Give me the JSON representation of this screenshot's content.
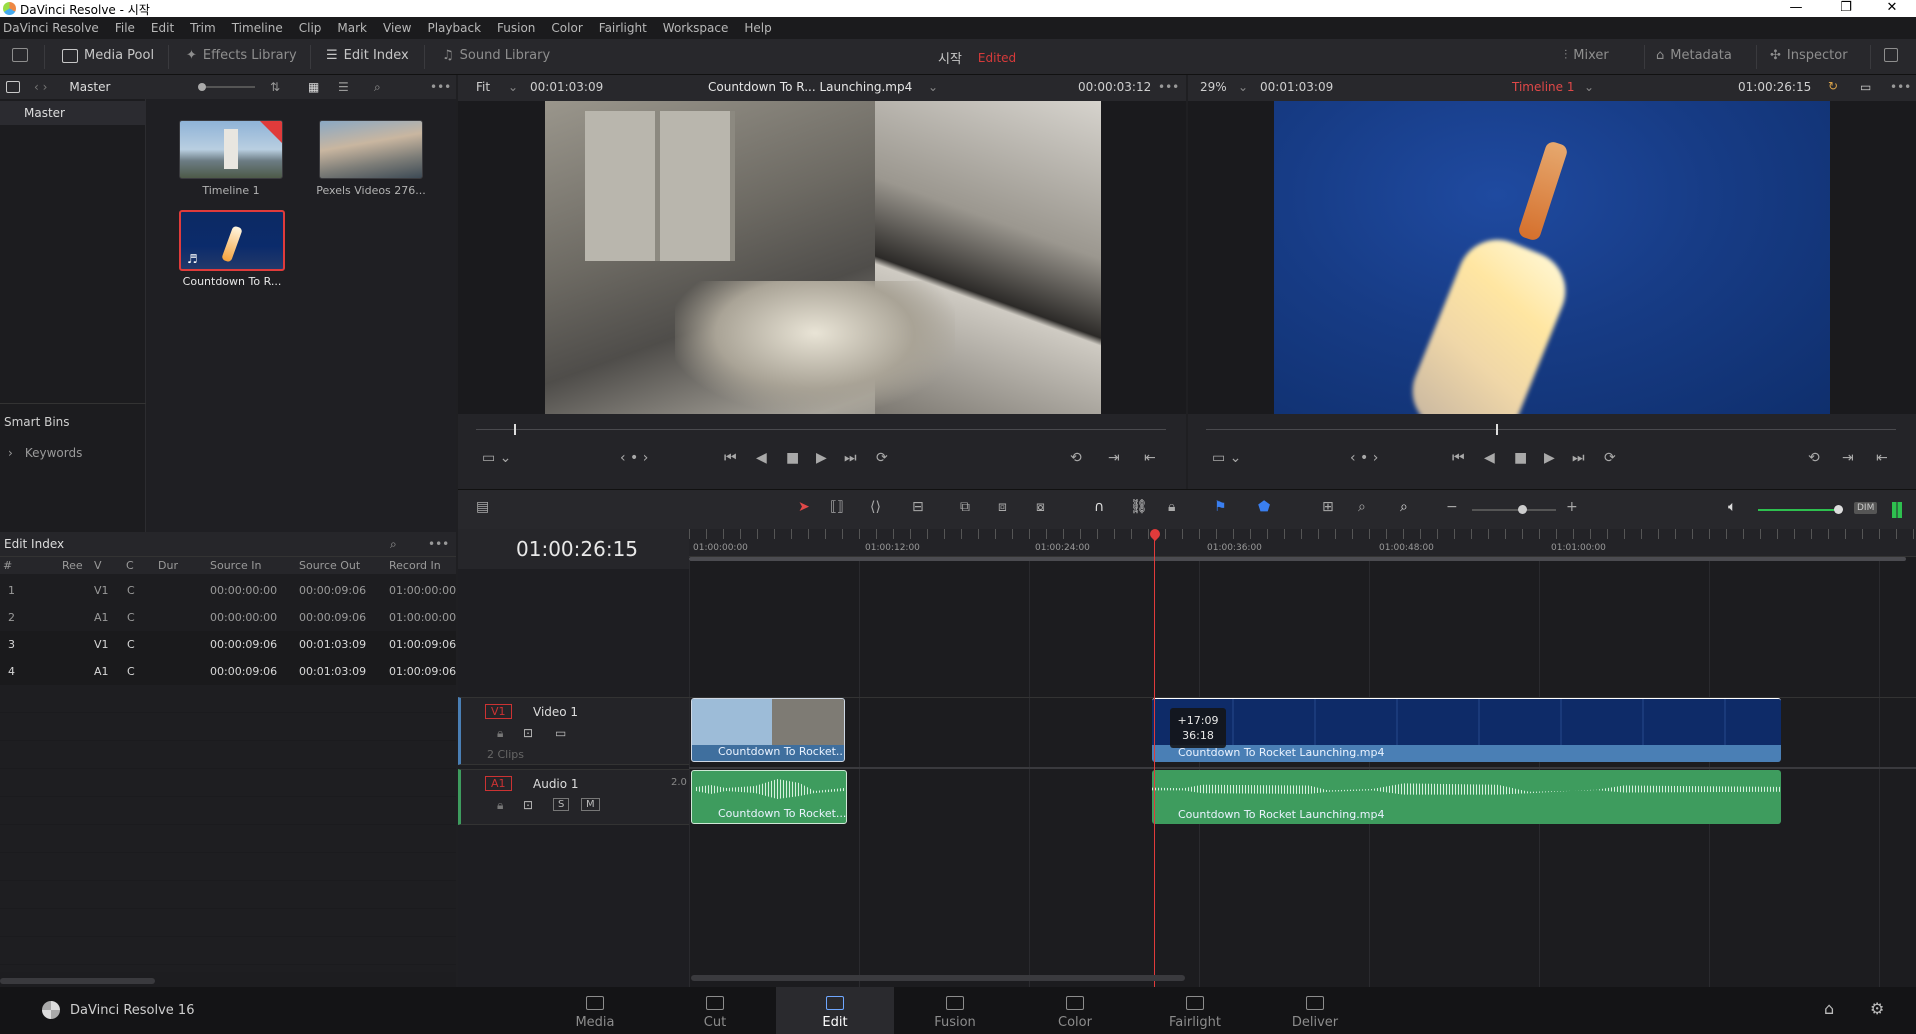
{
  "window": {
    "title": "DaVinci Resolve - 시작"
  },
  "menu": [
    "DaVinci Resolve",
    "File",
    "Edit",
    "Trim",
    "Timeline",
    "Clip",
    "Mark",
    "View",
    "Playback",
    "Fusion",
    "Color",
    "Fairlight",
    "Workspace",
    "Help"
  ],
  "toolbar": {
    "media_pool": "Media Pool",
    "effects_library": "Effects Library",
    "edit_index": "Edit Index",
    "sound_library": "Sound Library",
    "project_name": "시작",
    "project_status": "Edited",
    "mixer": "Mixer",
    "metadata": "Metadata",
    "inspector": "Inspector"
  },
  "media_pool": {
    "bin_label": "Master",
    "sidebar_master": "Master",
    "smart_bins": "Smart Bins",
    "keywords": "Keywords",
    "clips": [
      {
        "name": "Timeline 1"
      },
      {
        "name": "Pexels Videos 276..."
      },
      {
        "name": "Countdown To R..."
      }
    ]
  },
  "edit_index": {
    "title": "Edit Index",
    "columns": [
      "#",
      "Ree",
      "V",
      "C",
      "Dur",
      "Source In",
      "Source Out",
      "Record In"
    ],
    "rows": [
      {
        "num": "1",
        "track": "V1",
        "type": "C",
        "source_in": "00:00:00:00",
        "source_out": "00:00:09:06",
        "record_in": "01:00:00:00"
      },
      {
        "num": "2",
        "track": "A1",
        "type": "C",
        "source_in": "00:00:00:00",
        "source_out": "00:00:09:06",
        "record_in": "01:00:00:00"
      },
      {
        "num": "3",
        "track": "V1",
        "type": "C",
        "source_in": "00:00:09:06",
        "source_out": "00:01:03:09",
        "record_in": "01:00:09:06"
      },
      {
        "num": "4",
        "track": "A1",
        "type": "C",
        "source_in": "00:00:09:06",
        "source_out": "00:01:03:09",
        "record_in": "01:00:09:06"
      }
    ]
  },
  "source_viewer": {
    "zoom": "Fit",
    "duration": "00:01:03:09",
    "clip_name": "Countdown To R... Launching.mp4",
    "timecode": "00:00:03:12"
  },
  "timeline_viewer": {
    "zoom": "29%",
    "duration": "00:01:03:09",
    "timeline_name": "Timeline 1",
    "timecode": "01:00:26:15"
  },
  "timeline": {
    "current_timecode": "01:00:26:15",
    "ruler": [
      "01:00:00:00",
      "01:00:12:00",
      "01:00:24:00",
      "01:00:36:00",
      "01:00:48:00",
      "01:01:00:00"
    ],
    "video_track": {
      "id": "V1",
      "name": "Video 1",
      "clip_count": "2 Clips"
    },
    "audio_track": {
      "id": "A1",
      "name": "Audio 1",
      "channels": "2.0",
      "solo": "S",
      "mute": "M"
    },
    "clips": {
      "v1_a": "Countdown To Rocket...",
      "v1_b": "Countdown To Rocket Launching.mp4",
      "a1_a": "Countdown To Rocket...",
      "a1_b": "Countdown To Rocket Launching.mp4"
    },
    "trim_tooltip": {
      "offset": "+17:09",
      "duration": "36:18"
    },
    "dim": "DIM"
  },
  "pages": {
    "app_name": "DaVinci Resolve 16",
    "tabs": [
      "Media",
      "Cut",
      "Edit",
      "Fusion",
      "Color",
      "Fairlight",
      "Deliver"
    ],
    "active": "Edit"
  },
  "colors": {
    "accent_red": "#e03b3b",
    "video_clip": "#4a7fb5",
    "audio_clip": "#3e9c5e",
    "playhead": "#e03b3b"
  }
}
